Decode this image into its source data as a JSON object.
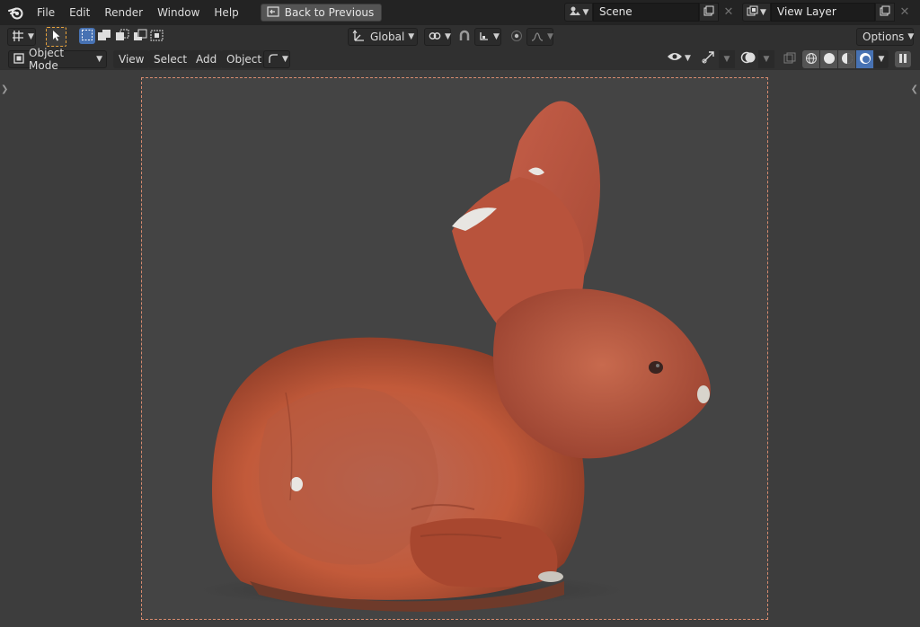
{
  "menubar": {
    "items": [
      "File",
      "Edit",
      "Render",
      "Window",
      "Help"
    ],
    "back_label": "Back to Previous",
    "scene_label": "Scene",
    "view_layer_label": "View Layer"
  },
  "header": {
    "transform_orientation": "Global",
    "options_label": "Options"
  },
  "viewport_header": {
    "mode_label": "Object Mode",
    "menus": [
      "View",
      "Select",
      "Add",
      "Object"
    ]
  },
  "viewport": {
    "content": "orange clay rabbit photogrammetry model",
    "frame_color": "#d88b6f"
  },
  "colors": {
    "accent": "#4772b3",
    "tool_active": "#e8a33c"
  }
}
